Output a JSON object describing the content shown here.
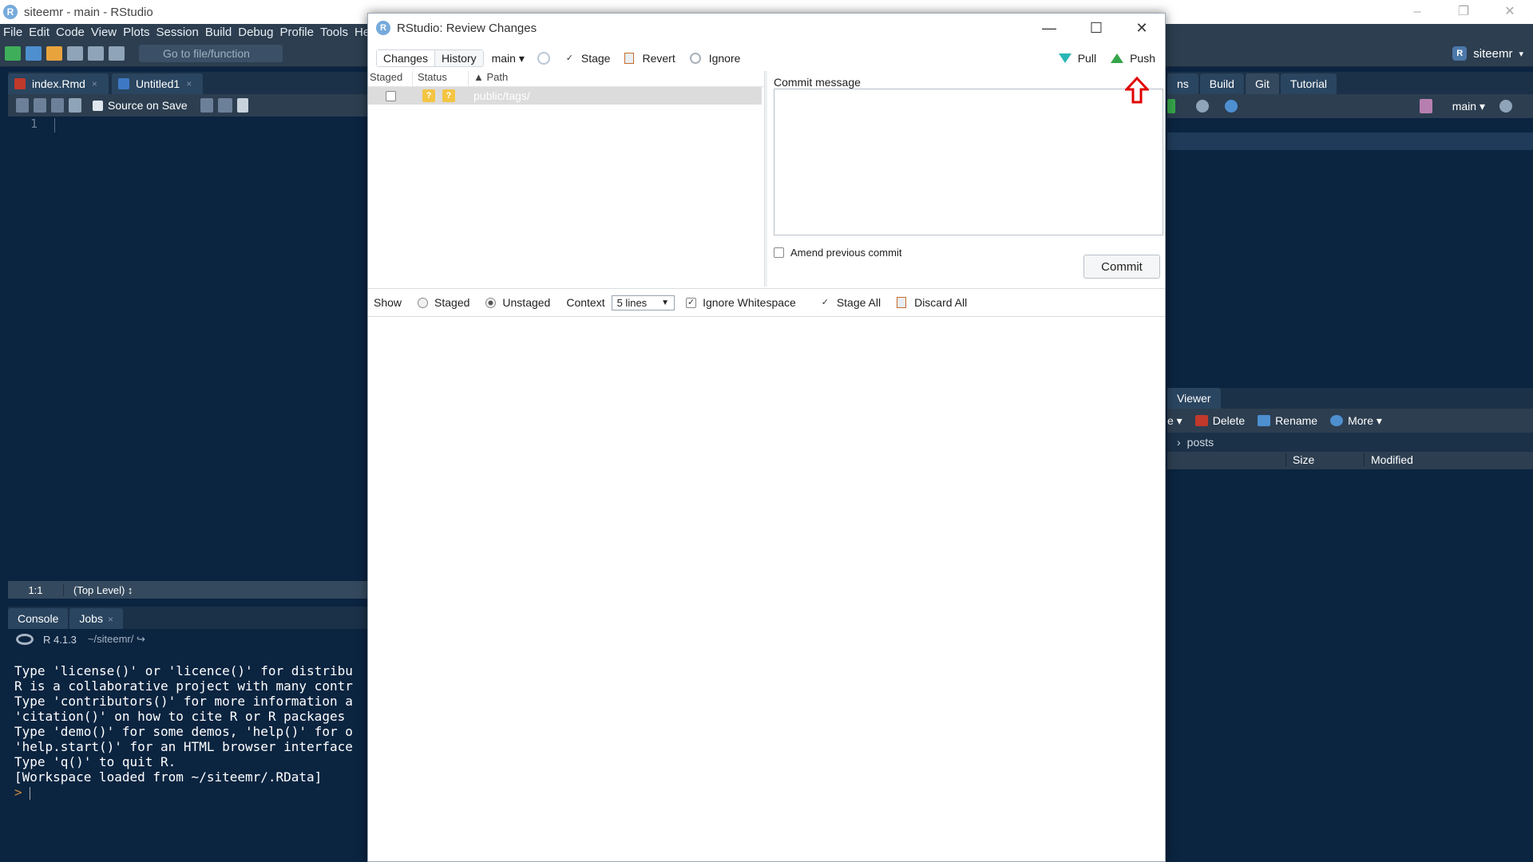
{
  "window": {
    "title": "siteemr - main - RStudio",
    "app_icon": "R",
    "controls": [
      "–",
      "❐",
      "✕"
    ]
  },
  "menu": [
    "File",
    "Edit",
    "Code",
    "View",
    "Plots",
    "Session",
    "Build",
    "Debug",
    "Profile",
    "Tools",
    "He"
  ],
  "toolbar": {
    "goto_placeholder": "Go to file/function",
    "project": "siteemr",
    "project_dropdown": "▾"
  },
  "editor": {
    "tabs": [
      {
        "label": "index.Rmd",
        "close": "×",
        "color": "#c0392b"
      },
      {
        "label": "Untitled1",
        "close": "×",
        "color": "#3d79c4"
      }
    ],
    "source_on_save": "Source on Save",
    "line_number": "1",
    "cursor_pos": "1:1",
    "scope": "(Top Level) ↕"
  },
  "console": {
    "tabs": [
      "Console",
      "Jobs"
    ],
    "jobs_close": "×",
    "r_version": "R 4.1.3",
    "working_dir": "~/siteemr/ ↪",
    "lines": [
      "Type 'license()' or 'licence()' for distribu",
      "",
      "R is a collaborative project with many contr",
      "Type 'contributors()' for more information a",
      "'citation()' on how to cite R or R packages",
      "",
      "Type 'demo()' for some demos, 'help()' for o",
      "'help.start()' for an HTML browser interface",
      "Type 'q()' to quit R.",
      "",
      "[Workspace loaded from ~/siteemr/.RData]",
      ""
    ],
    "prompt": "> "
  },
  "right_pane": {
    "tabs": [
      "ns",
      "Build",
      "Git",
      "Tutorial"
    ],
    "branch": "main ▾"
  },
  "files_pane": {
    "tabs": [
      "Viewer"
    ],
    "actions": {
      "delete": "Delete",
      "rename": "Rename",
      "more": "More ▾",
      "leading": "e ▾"
    },
    "path": "posts",
    "path_arrow": "›",
    "columns": {
      "size": "Size",
      "modified": "Modified"
    }
  },
  "dialog": {
    "title": "RStudio: Review Changes",
    "controls": [
      "—",
      "☐",
      "✕"
    ],
    "toolbar": {
      "changes": "Changes",
      "history": "History",
      "branch": "main ▾",
      "stage": "Stage",
      "revert": "Revert",
      "ignore": "Ignore",
      "pull": "Pull",
      "push": "Push"
    },
    "table": {
      "columns": {
        "staged": "Staged",
        "status": "Status",
        "path": "▲ Path"
      },
      "rows": [
        {
          "staged": false,
          "status": [
            "?",
            "?"
          ],
          "path": "public/tags/"
        }
      ]
    },
    "commit": {
      "label": "Commit message",
      "message": "",
      "amend": "Amend previous commit",
      "button": "Commit"
    },
    "diff_bar": {
      "show": "Show",
      "staged": "Staged",
      "unstaged": "Unstaged",
      "view_mode": "unstaged",
      "context": "Context",
      "context_value": "5 lines",
      "context_dd": "▼",
      "ignore_whitespace": "Ignore Whitespace",
      "ignore_whitespace_checked": true,
      "stage_all": "Stage All",
      "discard_all": "Discard All"
    }
  },
  "colors": {
    "rstudio_blue": "#0b2440",
    "toolbar": "#2c3e50",
    "push_green": "#35a54a",
    "pull_teal": "#2bb5b5",
    "annotation_red": "#e00000",
    "status_question": "#f4c542"
  },
  "annotation": {
    "arrow": "up-arrow-pointing-at-push"
  }
}
